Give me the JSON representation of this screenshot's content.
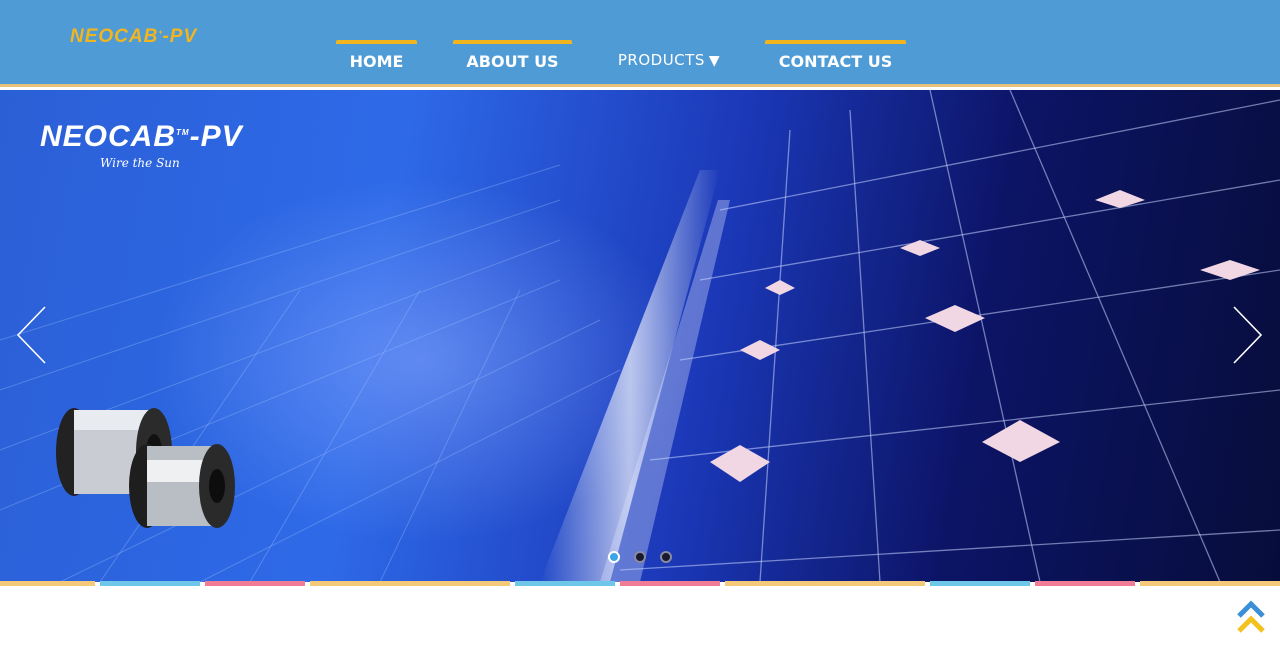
{
  "brand": {
    "logo_text": "NEOCAB",
    "logo_suffix": "-PV",
    "logo_mark": "+"
  },
  "nav": {
    "home": "HOME",
    "about": "ABOUT US",
    "products": "PRODUCTS",
    "products_caret": "▼",
    "contact": "CONTACT US"
  },
  "hero": {
    "brand_name": "NEOCAB",
    "brand_tm": "TM",
    "brand_suffix": "-PV",
    "tagline": "Wire the Sun",
    "slides_total": 3,
    "active_slide": 1
  },
  "colors": {
    "header_bg": "#4f9bd6",
    "accent": "#f3b51e",
    "stripe": [
      "#f5c97a",
      "#6ec6e8",
      "#f07d95"
    ]
  },
  "icons": {
    "prev": "chevron-left-icon",
    "next": "chevron-right-icon",
    "to_top": "double-chevron-up-icon"
  }
}
